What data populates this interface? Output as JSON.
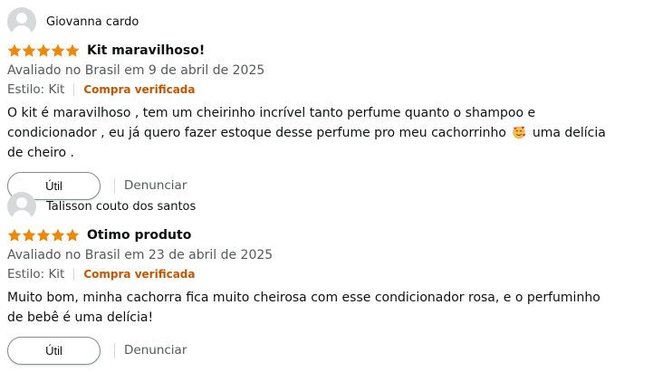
{
  "reviews": [
    {
      "author": "Giovanna cardo",
      "rating": 5,
      "title": "Kit maravilhoso!",
      "date": "Avaliado no Brasil em 9 de abril de 2025",
      "style": "Estilo: Kit",
      "verified": "Compra verificada",
      "body_before_emoji": "O kit é maravilhoso , tem um cheirinho incrível tanto perfume quanto o shampoo e condicionador , eu já quero fazer estoque desse perfume pro meu cachorrinho",
      "emoji": "smiling-face-with-hearts",
      "body_after_emoji": "uma delícia de cheiro .",
      "helpful_label": "Útil",
      "report_label": "Denunciar"
    },
    {
      "author": "Talisson couto dos santos",
      "rating": 5,
      "title": "Otimo produto",
      "date": "Avaliado no Brasil em 23 de abril de 2025",
      "style": "Estilo: Kit",
      "verified": "Compra verificada",
      "body": "Muito bom, minha cachorra fica muito cheirosa com esse condicionador rosa, e o perfuminho de bebê é uma delícia!",
      "helpful_label": "Útil",
      "report_label": "Denunciar"
    }
  ],
  "colors": {
    "star": "#f08804",
    "verified": "#c45500",
    "muted": "#565959"
  }
}
